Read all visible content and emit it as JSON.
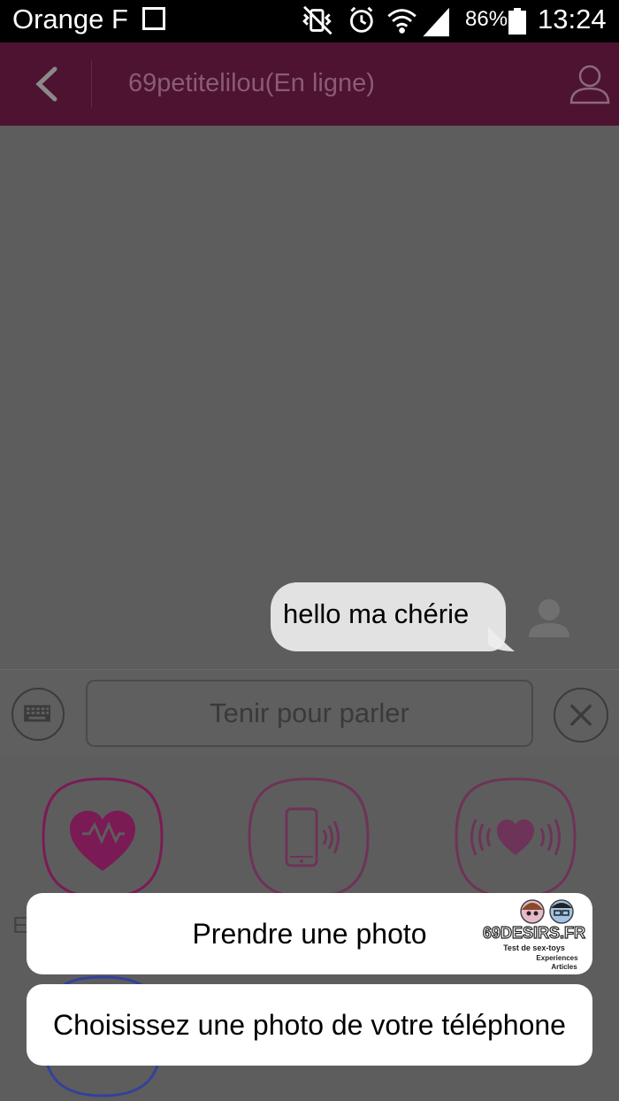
{
  "status_bar": {
    "carrier": "Orange F",
    "battery_percent": "86%",
    "time": "13:24",
    "icons": [
      "gallery-icon",
      "vibrate-mute-icon",
      "alarm-icon",
      "wifi-icon",
      "signal-icon",
      "battery-icon"
    ]
  },
  "header": {
    "title": "69petitelilou(En ligne)",
    "back_icon": "chevron-left-icon",
    "profile_icon": "profile-icon",
    "background": "#4e1330"
  },
  "chat": {
    "messages": [
      {
        "text": "hello ma chérie",
        "from": "me"
      }
    ]
  },
  "input_bar": {
    "hold_to_talk_label": "Tenir pour parler",
    "keyboard_icon": "keyboard-icon",
    "close_icon": "close-icon"
  },
  "panel": {
    "tiles": [
      "heart-pulse-icon",
      "phone-vibrate-icon",
      "heart-wave-icon"
    ],
    "partial_label": "E"
  },
  "sheet": {
    "take_photo": "Prendre une photo",
    "choose_photo": "Choisissez une photo de votre téléphone"
  },
  "watermark": {
    "brand": "69DESIRS.FR",
    "tagline": "Test de sex-toys",
    "line2": "Experiences",
    "line3": "Articles"
  },
  "colors": {
    "accent": "#9b1f6b",
    "overlay_bg": "#5d5d5d"
  }
}
